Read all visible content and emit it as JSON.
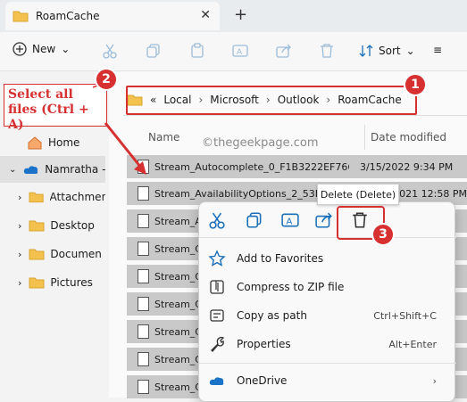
{
  "window": {
    "tab_title": "RoamCache",
    "close_glyph": "✕",
    "new_tab_glyph": "+"
  },
  "toolbar": {
    "new_label": "New",
    "sort_label": "Sort",
    "dropdown_glyph": "⌄",
    "more_glyph": "≡"
  },
  "address": {
    "back_glyph": "«",
    "crumbs": [
      "Local",
      "Microsoft",
      "Outlook",
      "RoamCache"
    ],
    "sep": "›"
  },
  "sidebar": {
    "items": [
      {
        "label": "Home",
        "icon": "home-icon"
      },
      {
        "label": "Namratha -",
        "icon": "onedrive-cloud-icon"
      },
      {
        "label": "Attachmen",
        "icon": "folder-icon"
      },
      {
        "label": "Desktop",
        "icon": "folder-icon"
      },
      {
        "label": "Documen",
        "icon": "folder-icon"
      },
      {
        "label": "Pictures",
        "icon": "folder-icon"
      }
    ]
  },
  "columns": {
    "name": "Name",
    "date": "Date modified"
  },
  "watermark": "©thegeekpage.com",
  "files": [
    {
      "name": "Stream_Autocomplete_0_F1B3222EF7665...",
      "date": "3/15/2022 9:34 PM"
    },
    {
      "name": "Stream_AvailabilityOptions_2_53E...",
      "date": "021 12:58 PM"
    },
    {
      "name": "Stream_A",
      "date": ""
    },
    {
      "name": "Stream_C",
      "date": ""
    },
    {
      "name": "Stream_C",
      "date": ""
    },
    {
      "name": "Stream_C",
      "date": ""
    },
    {
      "name": "Stream_C",
      "date": ""
    },
    {
      "name": "Stream_C",
      "date": ""
    },
    {
      "name": "Stream_C",
      "date": ""
    },
    {
      "name": "Stream_C",
      "date": ""
    }
  ],
  "context_menu": {
    "tooltip": "Delete (Delete)",
    "items": [
      {
        "label": "Add to Favorites",
        "shortcut": ""
      },
      {
        "label": "Compress to ZIP file",
        "shortcut": ""
      },
      {
        "label": "Copy as path",
        "shortcut": "Ctrl+Shift+C"
      },
      {
        "label": "Properties",
        "shortcut": "Alt+Enter"
      },
      {
        "label": "OneDrive",
        "shortcut": "›"
      }
    ]
  },
  "annotations": {
    "callout": "Select all files (Ctrl + A)",
    "steps": [
      "1",
      "2",
      "3"
    ],
    "accent": "#d63031"
  }
}
